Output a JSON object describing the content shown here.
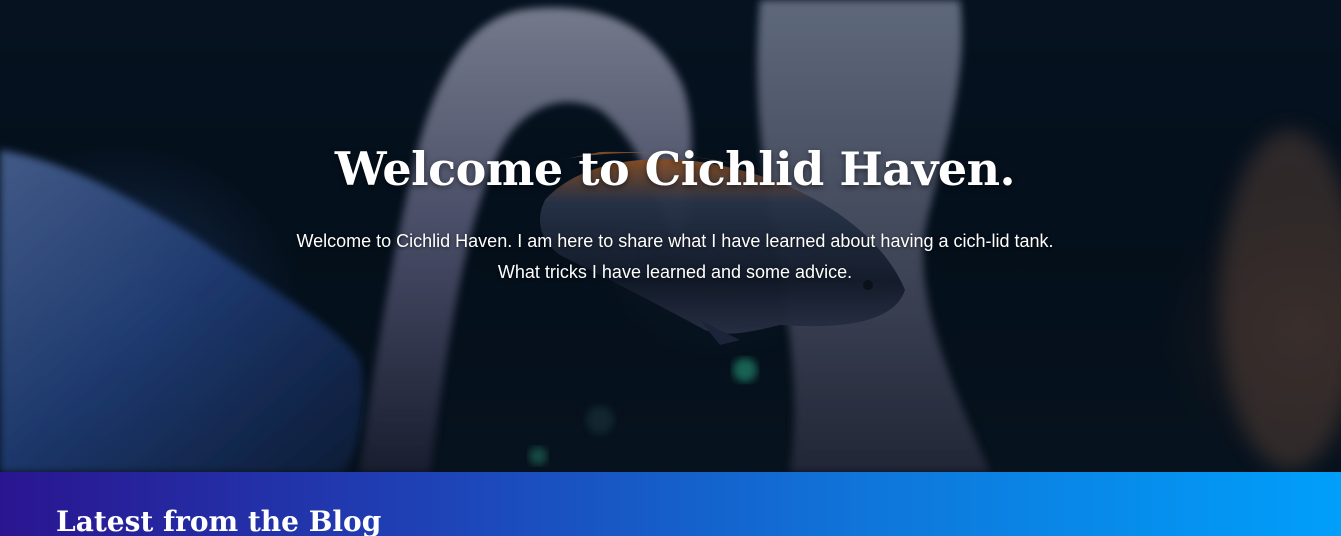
{
  "hero": {
    "title": "Welcome to Cichlid Haven.",
    "intro": "Welcome to Cichlid Haven. I am here to share what I have learned about having a cich-lid tank. What tricks I have learned and some advice.",
    "background_image": "aquarium-cichlid-photo"
  },
  "blog": {
    "heading": "Latest from the Blog"
  },
  "colors": {
    "band_gradient_start": "#2a1590",
    "band_gradient_end": "#009ffa",
    "text": "#ffffff"
  }
}
